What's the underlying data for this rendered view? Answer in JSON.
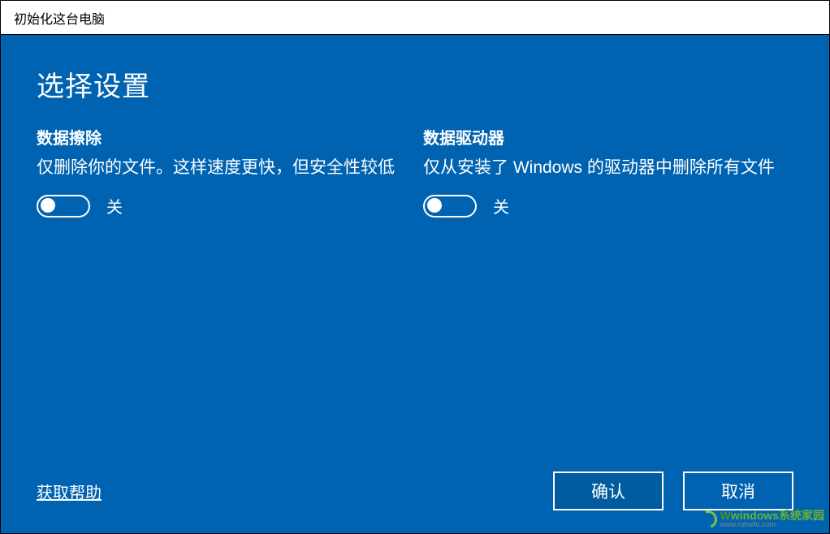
{
  "window": {
    "title": "初始化这台电脑"
  },
  "page": {
    "title": "选择设置"
  },
  "settings": {
    "data_erase": {
      "heading": "数据擦除",
      "description": "仅删除你的文件。这样速度更快，但安全性较低",
      "toggle_state": "off",
      "toggle_label": "关"
    },
    "data_drive": {
      "heading": "数据驱动器",
      "description": "仅从安装了 Windows 的驱动器中删除所有文件",
      "toggle_state": "off",
      "toggle_label": "关"
    }
  },
  "footer": {
    "help_link": "获取帮助",
    "confirm_button": "确认",
    "cancel_button": "取消"
  },
  "watermark": {
    "main": "windows系统家园",
    "sub": "www.ruhaifu.com"
  }
}
